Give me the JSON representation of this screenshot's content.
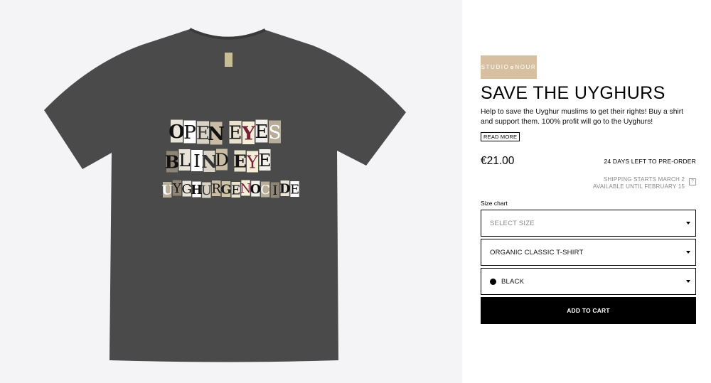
{
  "product_image": {
    "shirt_color": "#4a4a4a",
    "print_lines": [
      [
        "O",
        "P",
        "E",
        "N",
        " ",
        "E",
        "Y",
        "E",
        "S"
      ],
      [
        "B",
        "L",
        "I",
        "N",
        "D",
        " ",
        "E",
        "Y",
        "E"
      ],
      [
        "U",
        "Y",
        "G",
        "H",
        "U",
        "R",
        "G",
        "E",
        "N",
        "O",
        "C",
        "I",
        "D",
        "E"
      ]
    ]
  },
  "brand": {
    "name_left": "STUDIO",
    "name_right": "NOUR",
    "color": "#d7c0a2"
  },
  "product": {
    "title": "SAVE THE UYGHURS",
    "description": "Help to save the Uyghur muslims to get their rights! Buy a shirt and support them. 100% profit will go to the Uyghurs!",
    "read_more": "READ MORE",
    "price": "€21.00",
    "days_left": "24 DAYS LEFT TO PRE-ORDER",
    "shipping_line1": "SHIPPING STARTS MARCH 2",
    "shipping_line2": "AVAILABLE UNTIL FEBRUARY 15",
    "help_icon": "?",
    "size_chart": "Size chart"
  },
  "selects": {
    "size": "SELECT SIZE",
    "style": "ORGANIC CLASSIC T-SHIRT",
    "color": "BLACK"
  },
  "cart": {
    "label": "ADD TO CART"
  }
}
